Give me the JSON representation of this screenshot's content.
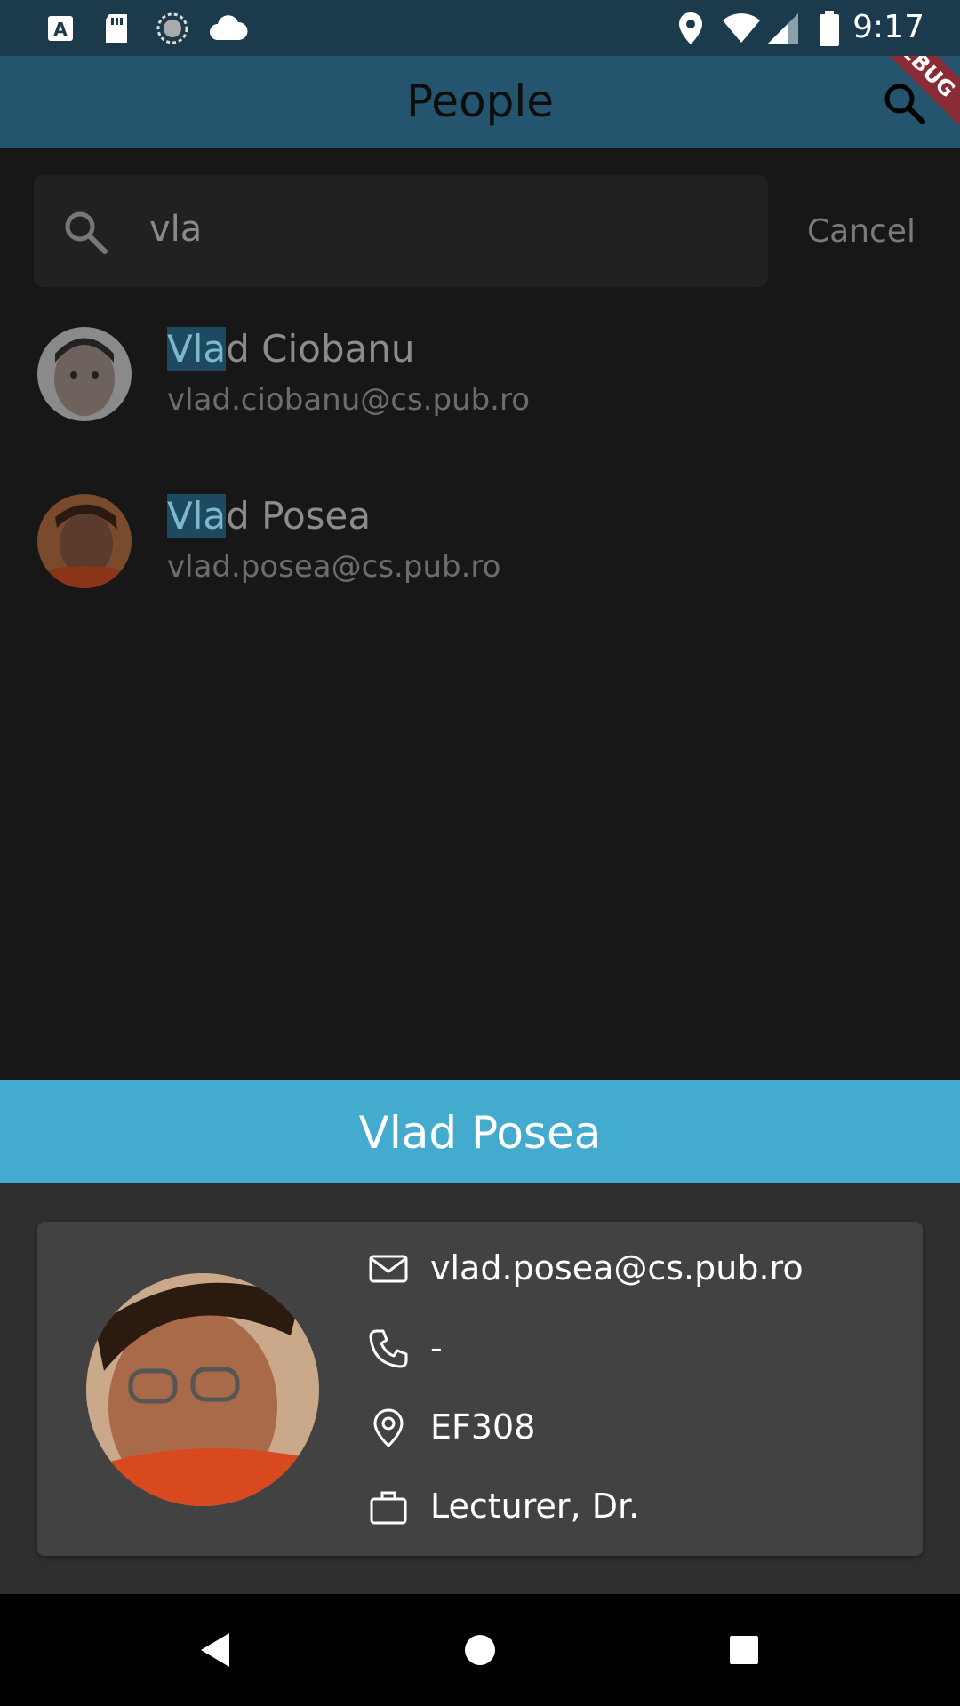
{
  "status_bar": {
    "time": "9:17",
    "icons": [
      "a-text-icon",
      "sd-card-icon",
      "sync-icon",
      "cloud-icon",
      "location-icon",
      "wifi-icon",
      "signal-icon",
      "battery-icon"
    ]
  },
  "app_bar": {
    "title": "People",
    "debug_label": "DEBUG"
  },
  "search": {
    "query": "vla",
    "cancel_label": "Cancel"
  },
  "results": [
    {
      "name_highlight": "Vla",
      "name_rest": "d Ciobanu",
      "email": "vlad.ciobanu@cs.pub.ro"
    },
    {
      "name_highlight": "Vla",
      "name_rest": "d Posea",
      "email": "vlad.posea@cs.pub.ro"
    }
  ],
  "detail": {
    "title": "Vlad Posea",
    "email": "vlad.posea@cs.pub.ro",
    "phone": "-",
    "office": "EF308",
    "position": "Lecturer, Dr."
  },
  "colors": {
    "status_bar": "#1b3a4c",
    "app_bar": "#25546f",
    "sheet_header": "#43abcd",
    "highlight": "#1d4a61"
  }
}
